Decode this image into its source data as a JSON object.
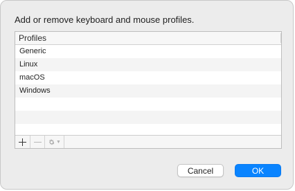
{
  "dialog": {
    "heading": "Add or remove keyboard and mouse profiles."
  },
  "table": {
    "column_header": "Profiles",
    "rows": [
      "Generic",
      "Linux",
      "macOS",
      "Windows",
      "",
      "",
      ""
    ]
  },
  "footer_buttons": {
    "add_icon": "plus-icon",
    "remove_icon": "minus-icon",
    "actions_icon": "gear-icon"
  },
  "buttons": {
    "cancel_label": "Cancel",
    "ok_label": "OK"
  },
  "colors": {
    "accent": "#0a84ff",
    "background": "#ececec"
  }
}
